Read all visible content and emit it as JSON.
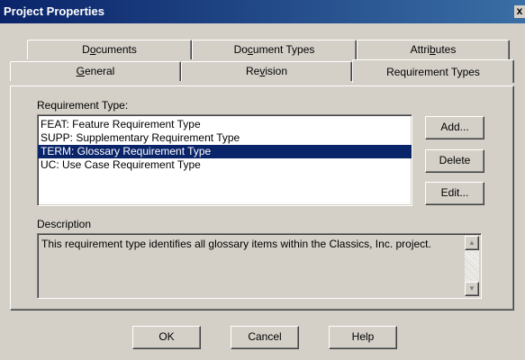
{
  "window": {
    "title": "Project Properties",
    "close_glyph": "x"
  },
  "tabs": {
    "row_back": [
      {
        "pre": "D",
        "ul": "o",
        "post": "cuments"
      },
      {
        "pre": "Do",
        "ul": "c",
        "post": "ument Types"
      },
      {
        "pre": "Attri",
        "ul": "b",
        "post": "utes"
      }
    ],
    "row_front": [
      {
        "pre": "",
        "ul": "G",
        "post": "eneral"
      },
      {
        "pre": "Re",
        "ul": "v",
        "post": "ision"
      },
      {
        "pre": "Requirement Types",
        "ul": "",
        "post": ""
      }
    ]
  },
  "requirement_types": {
    "label": "Requirement Type:",
    "items": [
      "FEAT: Feature Requirement Type",
      "SUPP: Supplementary Requirement Type",
      "TERM: Glossary Requirement Type",
      "UC: Use Case Requirement Type"
    ],
    "selected_index": 2
  },
  "side_buttons": {
    "add": "Add...",
    "delete": "Delete",
    "edit": "Edit..."
  },
  "description": {
    "label": "Description",
    "text": "This requirement type identifies all glossary items within the Classics, Inc. project.",
    "scroll_up_glyph": "▲",
    "scroll_down_glyph": "▼"
  },
  "footer_buttons": {
    "ok": "OK",
    "cancel": "Cancel",
    "help": "Help"
  }
}
